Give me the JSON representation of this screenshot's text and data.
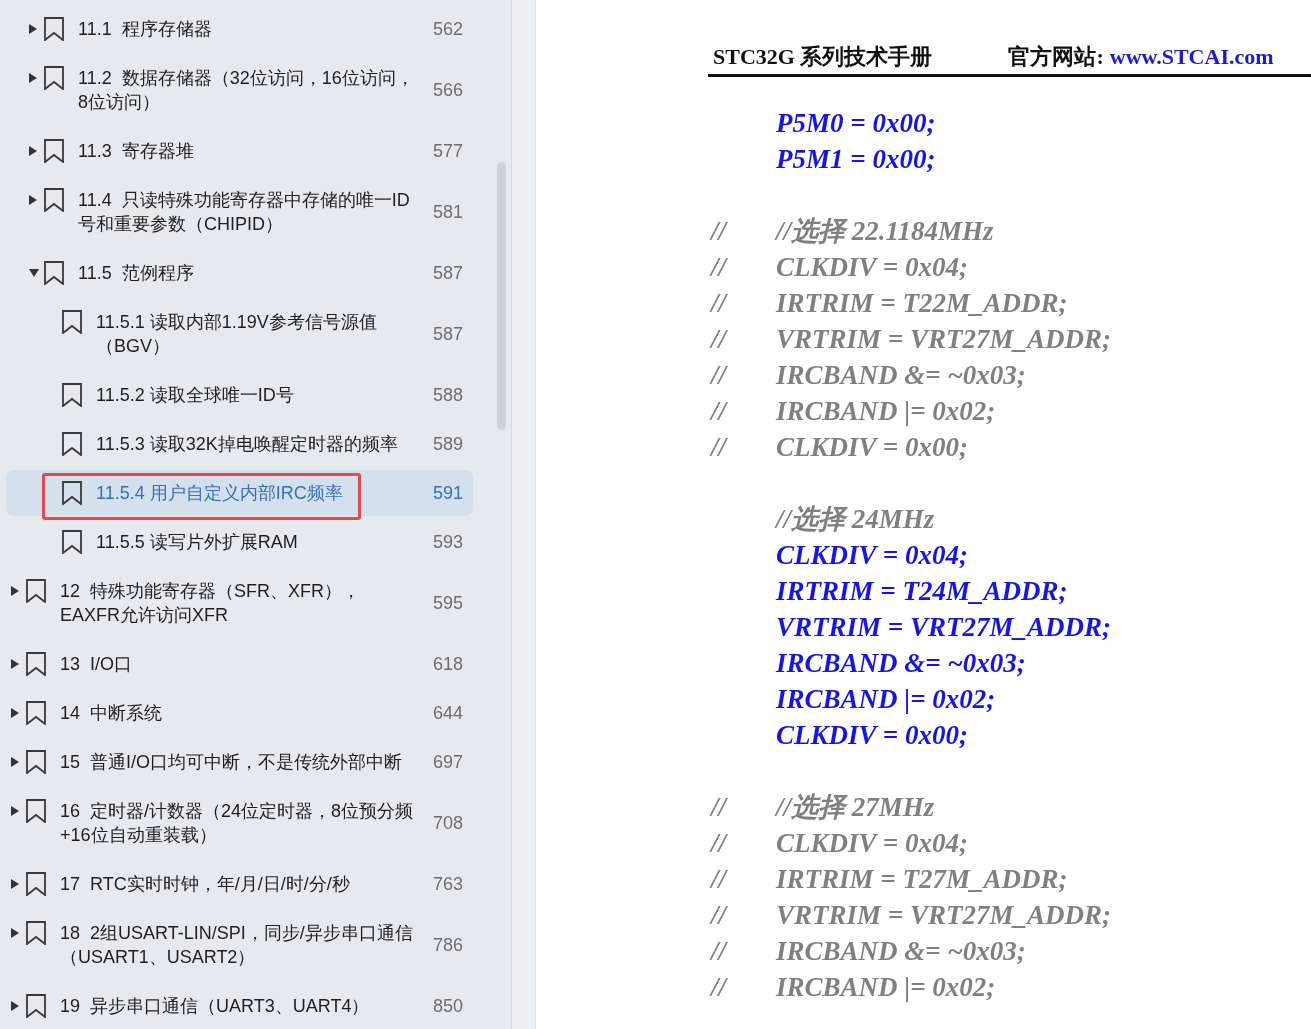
{
  "outline": [
    {
      "children": [
        {
          "label": "11.1  程序存储器",
          "page": "562",
          "expanded": false,
          "selected": false,
          "outlined": false
        },
        {
          "label": "11.2  数据存储器（32位访问，16位访问，8位访问）",
          "page": "566",
          "expanded": false,
          "selected": false,
          "outlined": false
        },
        {
          "label": "11.3  寄存器堆",
          "page": "577",
          "expanded": false,
          "selected": false,
          "outlined": false
        },
        {
          "label": "11.4  只读特殊功能寄存器中存储的唯一ID号和重要参数（CHIPID）",
          "page": "581",
          "expanded": false,
          "selected": false,
          "outlined": false
        },
        {
          "label": "11.5  范例程序",
          "page": "587",
          "expanded": true,
          "selected": false,
          "outlined": false,
          "children": [
            {
              "label": "11.5.1 读取内部1.19V参考信号源值（BGV）",
              "page": "587",
              "selected": false,
              "outlined": false
            },
            {
              "label": "11.5.2 读取全球唯一ID号",
              "page": "588",
              "selected": false,
              "outlined": false
            },
            {
              "label": "11.5.3 读取32K掉电唤醒定时器的频率",
              "page": "589",
              "selected": false,
              "outlined": false
            },
            {
              "label": "11.5.4 用户自定义内部IRC频率",
              "page": "591",
              "selected": true,
              "outlined": true
            },
            {
              "label": "11.5.5 读写片外扩展RAM",
              "page": "593",
              "selected": false,
              "outlined": false
            }
          ]
        }
      ]
    },
    {
      "label": "12  特殊功能寄存器（SFR、XFR），EAXFR允许访问XFR",
      "page": "595",
      "expanded": false,
      "selected": false,
      "outlined": false
    },
    {
      "label": "13  I/O口",
      "page": "618",
      "expanded": false,
      "selected": false,
      "outlined": false
    },
    {
      "label": "14  中断系统",
      "page": "644",
      "expanded": false,
      "selected": false,
      "outlined": false
    },
    {
      "label": "15  普通I/O口均可中断，不是传统外部中断",
      "page": "697",
      "expanded": false,
      "selected": false,
      "outlined": false
    },
    {
      "label": "16  定时器/计数器（24位定时器，8位预分频+16位自动重装载）",
      "page": "708",
      "expanded": false,
      "selected": false,
      "outlined": false
    },
    {
      "label": "17  RTC实时时钟，年/月/日/时/分/秒",
      "page": "763",
      "expanded": false,
      "selected": false,
      "outlined": false
    },
    {
      "label": "18  2组USART-LIN/SPI，同步/异步串口通信（USART1、USART2）",
      "page": "786",
      "expanded": false,
      "selected": false,
      "outlined": false
    },
    {
      "label": "19  异步串口通信（UART3、UART4）",
      "page": "850",
      "expanded": false,
      "selected": false,
      "outlined": false
    }
  ],
  "document_header": {
    "title": "STC32G 系列技术手册",
    "site_label": "官方网站:",
    "site_url": "www.STCAI.com"
  },
  "code_blocks": [
    {
      "lines": [
        {
          "kind": "code",
          "text": "P5M0 = 0x00;"
        },
        {
          "kind": "code",
          "text": "P5M1 = 0x00;"
        }
      ]
    },
    {
      "lines": [
        {
          "kind": "comment",
          "prefix": "//",
          "text": "//选择 22.1184MHz"
        },
        {
          "kind": "comment",
          "prefix": "//",
          "text": "CLKDIV = 0x04;"
        },
        {
          "kind": "comment",
          "prefix": "//",
          "text": "IRTRIM = T22M_ADDR;"
        },
        {
          "kind": "comment",
          "prefix": "//",
          "text": "VRTRIM = VRT27M_ADDR;"
        },
        {
          "kind": "comment",
          "prefix": "//",
          "text": "IRCBAND &= ~0x03;"
        },
        {
          "kind": "comment",
          "prefix": "//",
          "text": "IRCBAND |= 0x02;"
        },
        {
          "kind": "comment",
          "prefix": "//",
          "text": "CLKDIV = 0x00;"
        }
      ]
    },
    {
      "lines": [
        {
          "kind": "comment",
          "text": "//选择 24MHz"
        },
        {
          "kind": "code",
          "text": "CLKDIV = 0x04;"
        },
        {
          "kind": "code",
          "text": "IRTRIM = T24M_ADDR;"
        },
        {
          "kind": "code",
          "text": "VRTRIM = VRT27M_ADDR;"
        },
        {
          "kind": "code",
          "text": "IRCBAND &= ~0x03;"
        },
        {
          "kind": "code",
          "text": "IRCBAND |= 0x02;"
        },
        {
          "kind": "code",
          "text": "CLKDIV = 0x00;"
        }
      ]
    },
    {
      "lines": [
        {
          "kind": "comment",
          "prefix": "//",
          "text": "//选择 27MHz"
        },
        {
          "kind": "comment",
          "prefix": "//",
          "text": "CLKDIV = 0x04;"
        },
        {
          "kind": "comment",
          "prefix": "//",
          "text": "IRTRIM = T27M_ADDR;"
        },
        {
          "kind": "comment",
          "prefix": "//",
          "text": "VRTRIM = VRT27M_ADDR;"
        },
        {
          "kind": "comment",
          "prefix": "//",
          "text": "IRCBAND &= ~0x03;"
        },
        {
          "kind": "comment",
          "prefix": "//",
          "text": "IRCBAND |= 0x02;"
        }
      ]
    }
  ]
}
